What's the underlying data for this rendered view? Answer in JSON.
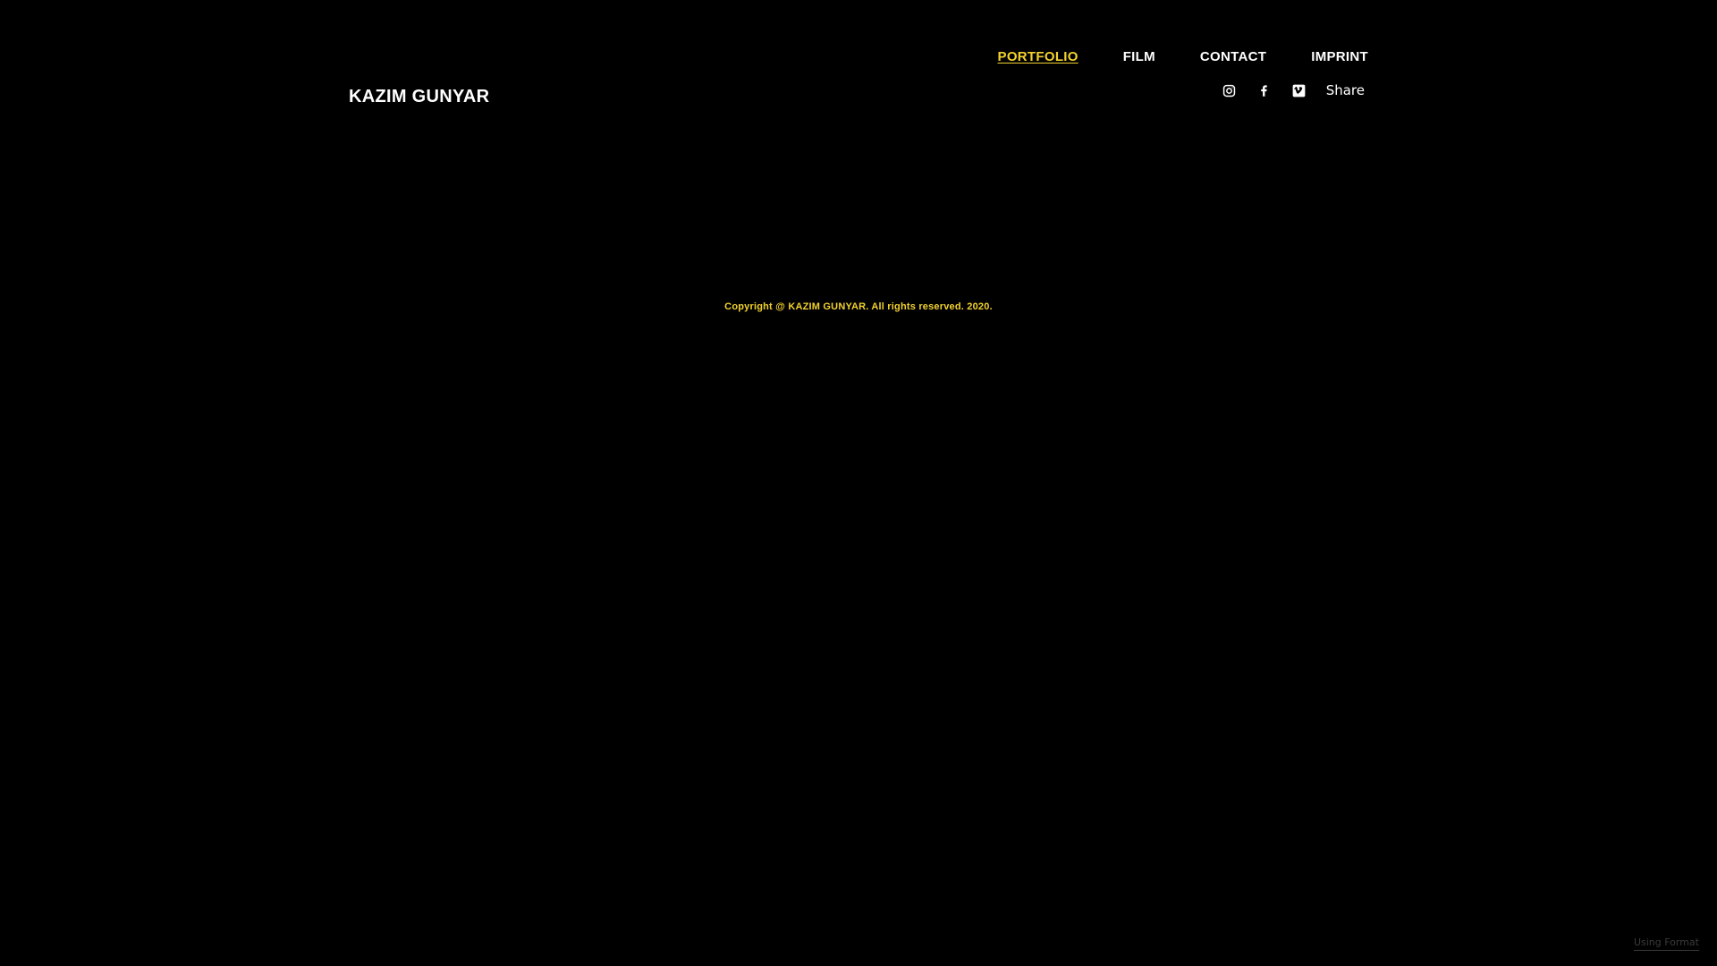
{
  "site": {
    "title": "KAZIM GUNYAR"
  },
  "nav": {
    "items": [
      {
        "label": "PORTFOLIO",
        "active": true
      },
      {
        "label": "FILM",
        "active": false
      },
      {
        "label": "CONTACT",
        "active": false
      },
      {
        "label": "IMPRINT",
        "active": false
      }
    ]
  },
  "social": {
    "icons": [
      "instagram-icon",
      "facebook-icon",
      "vimeo-icon"
    ],
    "share_label": "Share"
  },
  "footer": {
    "copyright": "Copyright @ KAZIM GUNYAR. All rights reserved. 2020.",
    "powered_by": "Using Format"
  },
  "colors": {
    "background": "#000000",
    "text": "#ffffff",
    "accent": "#f2d22e",
    "muted": "#3a3a3a"
  }
}
